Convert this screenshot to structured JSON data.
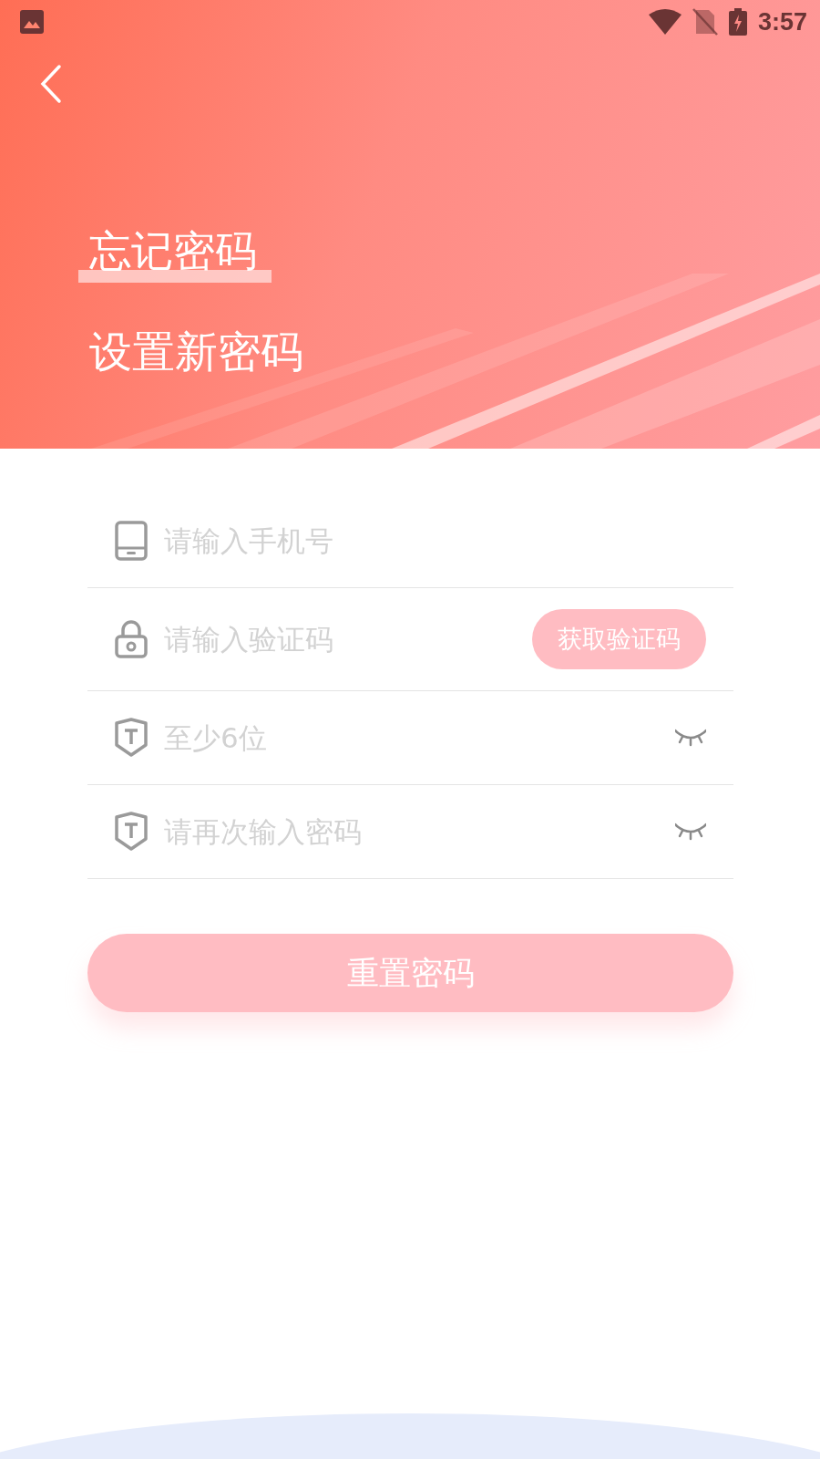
{
  "status_bar": {
    "time": "3:57"
  },
  "header": {
    "title": "忘记密码",
    "subtitle": "设置新密码"
  },
  "fields": [
    {
      "kind": "phone",
      "placeholder": "请输入手机号"
    },
    {
      "kind": "code",
      "placeholder": "请输入验证码",
      "action": "获取验证码"
    },
    {
      "kind": "password",
      "placeholder": "至少6位"
    },
    {
      "kind": "password",
      "placeholder": "请再次输入密码"
    }
  ],
  "submit": "重置密码"
}
